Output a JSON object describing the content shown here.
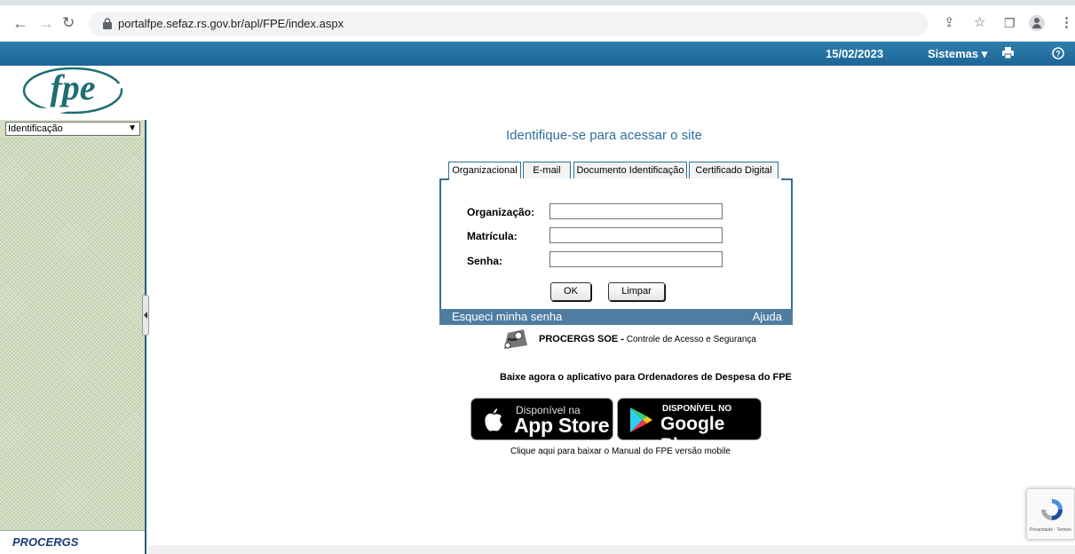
{
  "browser": {
    "url": "portalfpe.sefaz.rs.gov.br/apl/FPE/index.aspx",
    "icons": [
      "back-arrow-icon",
      "forward-arrow-icon",
      "reload-icon",
      "lock-icon",
      "share-icon",
      "star-icon",
      "side-panel-icon",
      "profile-icon",
      "menu-dots-icon"
    ]
  },
  "topbar": {
    "date": "15/02/2023",
    "systems_label": "Sistemas",
    "systems_caret": "▾",
    "print_icon": "printer-icon",
    "help_icon": "help-icon"
  },
  "sidebar": {
    "logo_text": "fpe",
    "select_value": "Identificação",
    "footer_logo": "PROCERGS"
  },
  "login": {
    "title": "Identifique-se para acessar o site",
    "tabs": [
      {
        "label": "Organizacional",
        "active": true
      },
      {
        "label": "E-mail",
        "active": false
      },
      {
        "label": "Documento Identificação",
        "active": false
      },
      {
        "label": "Certificado Digital",
        "active": false
      }
    ],
    "fields": {
      "organization_label": "Organização:",
      "organization_value": "",
      "registration_label": "Matrícula:",
      "registration_value": "",
      "password_label": "Senha:",
      "password_value": ""
    },
    "ok_button": "OK",
    "clear_button": "Limpar",
    "forgot_link": "Esqueci minha senha",
    "help_link": "Ajuda"
  },
  "soe": {
    "brand": "PROCERGS SOE -",
    "description": " Controle de Acesso e Segurança"
  },
  "promo": {
    "text": "Baixe agora o aplicativo para Ordenadores de Despesa do FPE",
    "appstore_small": "Disponível na",
    "appstore_big": "App Store",
    "googleplay_small": "DISPONÍVEL NO",
    "googleplay_big": "Google Play",
    "manual_link": "Clique aqui para baixar o Manual do FPE versão mobile"
  },
  "recaptcha": {
    "footer": "Privacidade - Termos"
  },
  "colors": {
    "topbar": "#2371a3",
    "panel_border": "#2f6f9a",
    "panel_bar": "#4f7da1",
    "sidebar": "#d4dfc4"
  }
}
